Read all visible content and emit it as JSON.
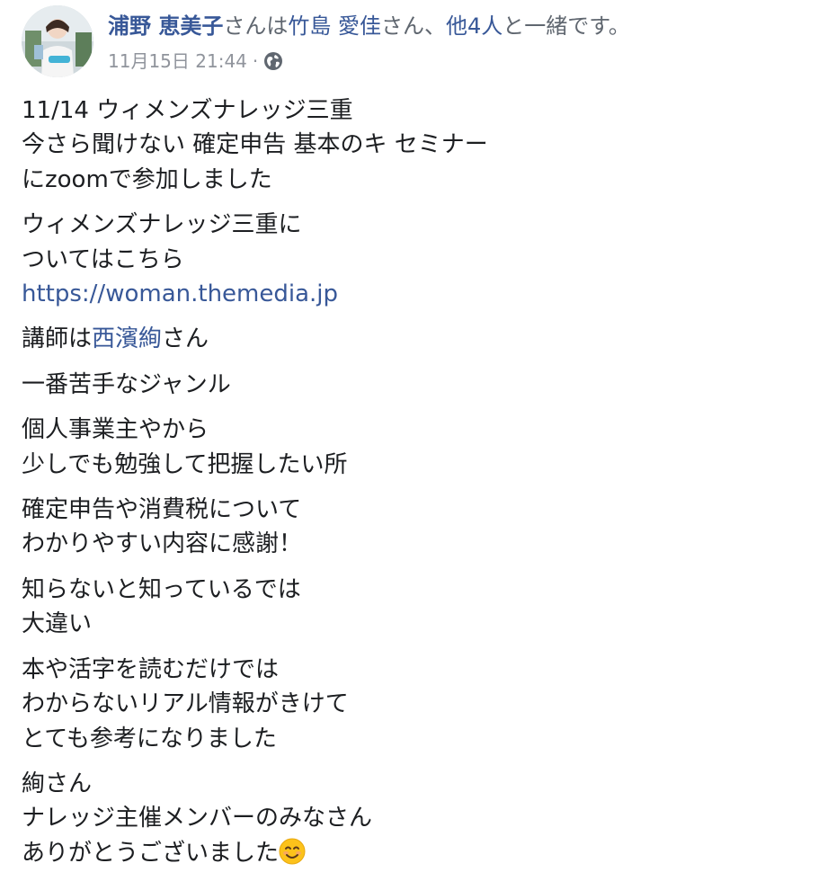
{
  "header": {
    "author": "浦野 恵美子",
    "phrase_1": "さんは",
    "tagged": "竹島 愛佳",
    "phrase_2": "さん、",
    "others": "他4人",
    "phrase_3": "と一緒です。"
  },
  "meta": {
    "timestamp": "11月15日 21:44",
    "separator": "·",
    "privacy_icon": "globe-icon"
  },
  "body": {
    "p1": [
      "11/14 ウィメンズナレッジ三重",
      "今さら聞けない 確定申告 基本のキ セミナー",
      "にzoomで参加しました"
    ],
    "p2": [
      "ウィメンズナレッジ三重に",
      "ついてはこちら"
    ],
    "p2_link": "https://woman.themedia.jp",
    "p3_prefix": "講師は",
    "p3_link": "西濱絢",
    "p3_suffix": "さん",
    "p4": [
      "一番苦手なジャンル"
    ],
    "p5": [
      "個人事業主やから",
      "少しでも勉強して把握したい所"
    ],
    "p6": [
      "確定申告や消費税について",
      "わかりやすい内容に感謝！"
    ],
    "p7": [
      "知らないと知っているでは",
      "大違い"
    ],
    "p8": [
      "本や活字を読むだけでは",
      "わからないリアル情報がきけて",
      "とても参考になりました"
    ],
    "p9": [
      "絢さん",
      "ナレッジ主催メンバーのみなさん"
    ],
    "p9_last": "ありがとうございました",
    "emoji_icon": "smiling-face-emoji-icon"
  },
  "colors": {
    "link": "#385898",
    "text": "#1c1e21",
    "muted": "#90949c"
  }
}
